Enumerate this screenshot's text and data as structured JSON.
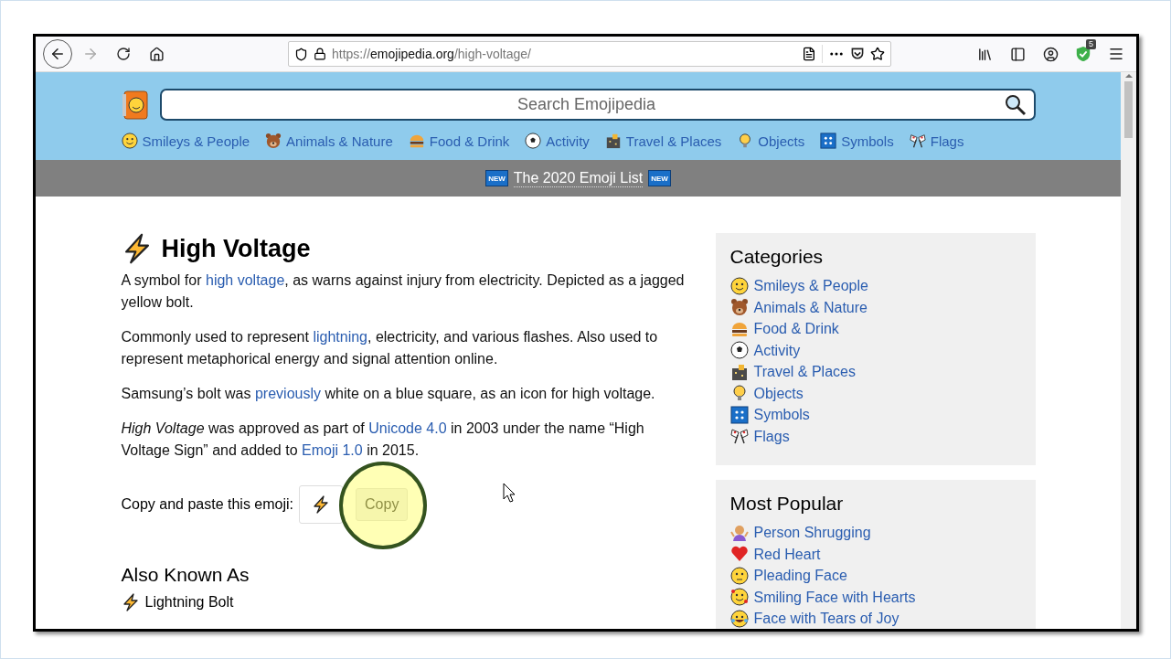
{
  "browser": {
    "url": {
      "scheme": "https://",
      "host": "emojipedia.org",
      "path": "/high-voltage/"
    },
    "extension_badge": "5"
  },
  "site": {
    "search": {
      "placeholder": "Search Emojipedia"
    },
    "nav": [
      "Smileys & People",
      "Animals & Nature",
      "Food & Drink",
      "Activity",
      "Travel & Places",
      "Objects",
      "Symbols",
      "Flags"
    ],
    "banner": {
      "badge_left": "NEW",
      "text": "The 2020 Emoji List",
      "badge_right": "NEW"
    }
  },
  "article": {
    "title": "High Voltage",
    "paragraphs": [
      [
        {
          "kind": "text",
          "text": "A symbol for "
        },
        {
          "kind": "link",
          "text": "high voltage"
        },
        {
          "kind": "text",
          "text": ", as warns against injury from electricity. Depicted as a jagged yellow bolt."
        }
      ],
      [
        {
          "kind": "text",
          "text": "Commonly used to represent "
        },
        {
          "kind": "link",
          "text": "lightning"
        },
        {
          "kind": "text",
          "text": ", electricity, and various flashes. Also used to represent metaphorical energy and signal attention online."
        }
      ],
      [
        {
          "kind": "text",
          "text": "Samsung’s bolt was "
        },
        {
          "kind": "link",
          "text": "previously"
        },
        {
          "kind": "text",
          "text": " white on a blue square, as an icon for high voltage."
        }
      ],
      [
        {
          "kind": "text",
          "text": "*High Voltage* was approved as part of "
        },
        {
          "kind": "link",
          "text": "Unicode 4.0"
        },
        {
          "kind": "text",
          "text": " in 2003 under the name “High Voltage Sign” and added to "
        },
        {
          "kind": "link",
          "text": "Emoji 1.0"
        },
        {
          "kind": "text",
          "text": " in 2015."
        }
      ]
    ],
    "copy": {
      "label": "Copy and paste this emoji:",
      "button": "Copy"
    },
    "aka_heading": "Also Known As",
    "aka": [
      "Lightning Bolt"
    ]
  },
  "sidebar": [
    {
      "title": "Categories",
      "items": [
        "Smileys & People",
        "Animals & Nature",
        "Food & Drink",
        "Activity",
        "Travel & Places",
        "Objects",
        "Symbols",
        "Flags"
      ]
    },
    {
      "title": "Most Popular",
      "items": [
        "Person Shrugging",
        "Red Heart",
        "Pleading Face",
        "Smiling Face with Hearts",
        "Face with Tears of Joy"
      ]
    }
  ]
}
